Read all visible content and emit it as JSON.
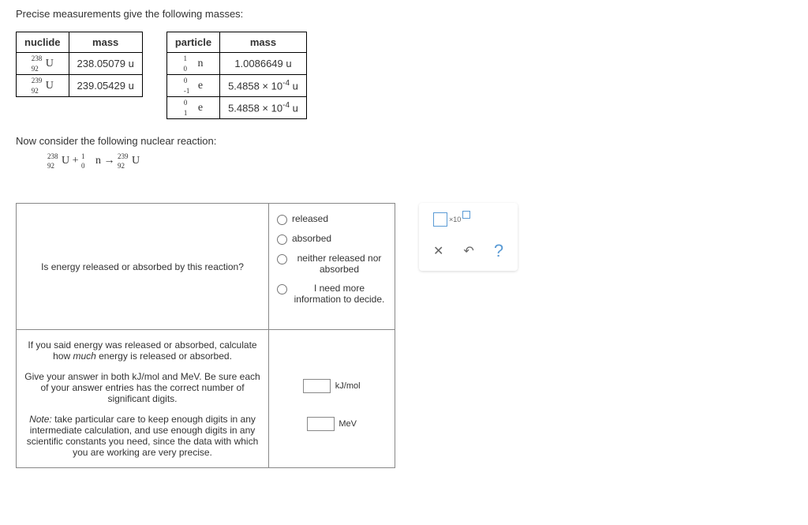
{
  "intro": "Precise measurements give the following masses:",
  "nuclideTable": {
    "headers": [
      "nuclide",
      "mass"
    ],
    "rows": [
      {
        "sup": "238",
        "sub": "92",
        "sym": "U",
        "mass": "238.05079 u"
      },
      {
        "sup": "239",
        "sub": "92",
        "sym": "U",
        "mass": "239.05429 u"
      }
    ]
  },
  "particleTable": {
    "headers": [
      "particle",
      "mass"
    ],
    "rows": [
      {
        "sup": "1",
        "sub": "0",
        "sym": "n",
        "mass": "1.0086649 u"
      },
      {
        "sup": "0",
        "sub": "-1",
        "sym": "e",
        "massPrefix": "5.4858 × 10",
        "massExp": "-4",
        "massSuffix": " u"
      },
      {
        "sup": "0",
        "sub": "1",
        "sym": "e",
        "massPrefix": "5.4858 × 10",
        "massExp": "-4",
        "massSuffix": " u"
      }
    ]
  },
  "considerLabel": "Now consider the following nuclear reaction:",
  "reaction": {
    "r1": {
      "sup": "238",
      "sub": "92",
      "sym": "U"
    },
    "plus": " + ",
    "r2": {
      "sup": "1",
      "sub": "0",
      "sym": "n"
    },
    "arrow": " → ",
    "p1": {
      "sup": "239",
      "sub": "92",
      "sym": "U"
    }
  },
  "question1": "Is energy released or absorbed by this reaction?",
  "options": {
    "o1": "released",
    "o2": "absorbed",
    "o3": "neither released nor absorbed",
    "o4": "I need more information to decide."
  },
  "question2a": "If you said energy was released or absorbed, calculate how ",
  "question2a_em": "much",
  "question2a_end": " energy is released or absorbed.",
  "question2b": "Give your answer in both kJ/mol and MeV. Be sure each of your answer entries has the correct number of significant digits.",
  "question2c_prefix": "Note:",
  "question2c": " take particular care to keep enough digits in any intermediate calculation, and use enough digits in any scientific constants you need, since the data with which you are working are very precise.",
  "units": {
    "u1": "kJ/mol",
    "u2": "MeV"
  },
  "toolbar": {
    "x10": "×10"
  }
}
